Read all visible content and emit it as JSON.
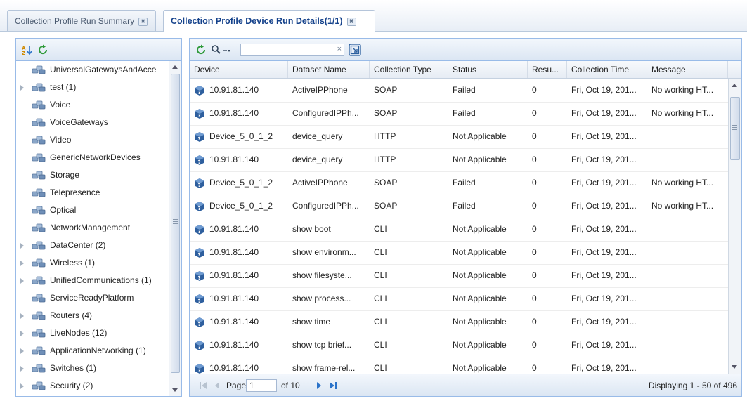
{
  "tabs": [
    {
      "label": "Collection Profile Run Summary",
      "active": false
    },
    {
      "label": "Collection Profile Device Run Details(1/1)",
      "active": true
    }
  ],
  "tab_close_glyph": "✖",
  "left": {
    "tree_items": [
      {
        "label": "UniversalGatewaysAndAcce",
        "expandable": false
      },
      {
        "label": "test (1)",
        "expandable": true
      },
      {
        "label": "Voice",
        "expandable": false
      },
      {
        "label": "VoiceGateways",
        "expandable": false
      },
      {
        "label": "Video",
        "expandable": false
      },
      {
        "label": "GenericNetworkDevices",
        "expandable": false
      },
      {
        "label": "Storage",
        "expandable": false
      },
      {
        "label": "Telepresence",
        "expandable": false
      },
      {
        "label": "Optical",
        "expandable": false
      },
      {
        "label": "NetworkManagement",
        "expandable": false
      },
      {
        "label": "DataCenter (2)",
        "expandable": true
      },
      {
        "label": "Wireless (1)",
        "expandable": true
      },
      {
        "label": "UnifiedCommunications (1)",
        "expandable": true
      },
      {
        "label": "ServiceReadyPlatform",
        "expandable": false
      },
      {
        "label": "Routers (4)",
        "expandable": true
      },
      {
        "label": "LiveNodes (12)",
        "expandable": true
      },
      {
        "label": "ApplicationNetworking (1)",
        "expandable": true
      },
      {
        "label": "Switches (1)",
        "expandable": true
      },
      {
        "label": "Security (2)",
        "expandable": true
      }
    ]
  },
  "grid": {
    "search_value": "",
    "search_clear_glyph": "×",
    "columns": [
      "Device",
      "Dataset Name",
      "Collection Type",
      "Status",
      "Resu...",
      "Collection Time",
      "Message"
    ],
    "rows": [
      [
        "10.91.81.140",
        "ActiveIPPhone",
        "SOAP",
        "Failed",
        "0",
        "Fri, Oct 19, 201...",
        "No working HT..."
      ],
      [
        "10.91.81.140",
        "ConfiguredIPPh...",
        "SOAP",
        "Failed",
        "0",
        "Fri, Oct 19, 201...",
        "No working HT..."
      ],
      [
        "Device_5_0_1_2",
        "device_query",
        "HTTP",
        "Not Applicable",
        "0",
        "Fri, Oct 19, 201...",
        ""
      ],
      [
        "10.91.81.140",
        "device_query",
        "HTTP",
        "Not Applicable",
        "0",
        "Fri, Oct 19, 201...",
        ""
      ],
      [
        "Device_5_0_1_2",
        "ActiveIPPhone",
        "SOAP",
        "Failed",
        "0",
        "Fri, Oct 19, 201...",
        "No working HT..."
      ],
      [
        "Device_5_0_1_2",
        "ConfiguredIPPh...",
        "SOAP",
        "Failed",
        "0",
        "Fri, Oct 19, 201...",
        "No working HT..."
      ],
      [
        "10.91.81.140",
        "show boot",
        "CLI",
        "Not Applicable",
        "0",
        "Fri, Oct 19, 201...",
        ""
      ],
      [
        "10.91.81.140",
        "show environm...",
        "CLI",
        "Not Applicable",
        "0",
        "Fri, Oct 19, 201...",
        ""
      ],
      [
        "10.91.81.140",
        "show filesyste...",
        "CLI",
        "Not Applicable",
        "0",
        "Fri, Oct 19, 201...",
        ""
      ],
      [
        "10.91.81.140",
        "show process...",
        "CLI",
        "Not Applicable",
        "0",
        "Fri, Oct 19, 201...",
        ""
      ],
      [
        "10.91.81.140",
        "show time",
        "CLI",
        "Not Applicable",
        "0",
        "Fri, Oct 19, 201...",
        ""
      ],
      [
        "10.91.81.140",
        "show tcp brief...",
        "CLI",
        "Not Applicable",
        "0",
        "Fri, Oct 19, 201...",
        ""
      ],
      [
        "10.91.81.140",
        "show frame-rel...",
        "CLI",
        "Not Applicable",
        "0",
        "Fri, Oct 19, 201...",
        ""
      ]
    ]
  },
  "pager": {
    "page_label": "Page",
    "page_value": "1",
    "of_label": "of 10",
    "display_msg": "Displaying 1 - 50 of 496"
  },
  "colors": {
    "accent": "#15428b",
    "panel_border": "#99bbe8",
    "device_icon": "#2e5f9e",
    "arrow_blue": "#2b73c9"
  },
  "icons": {
    "left_toolbar": [
      "sort-icon",
      "refresh-icon"
    ],
    "grid_toolbar": [
      "refresh-icon",
      "search-dropdown-icon",
      "export-icon"
    ],
    "tree_node": "device-group-icon",
    "device": "device-icon"
  }
}
